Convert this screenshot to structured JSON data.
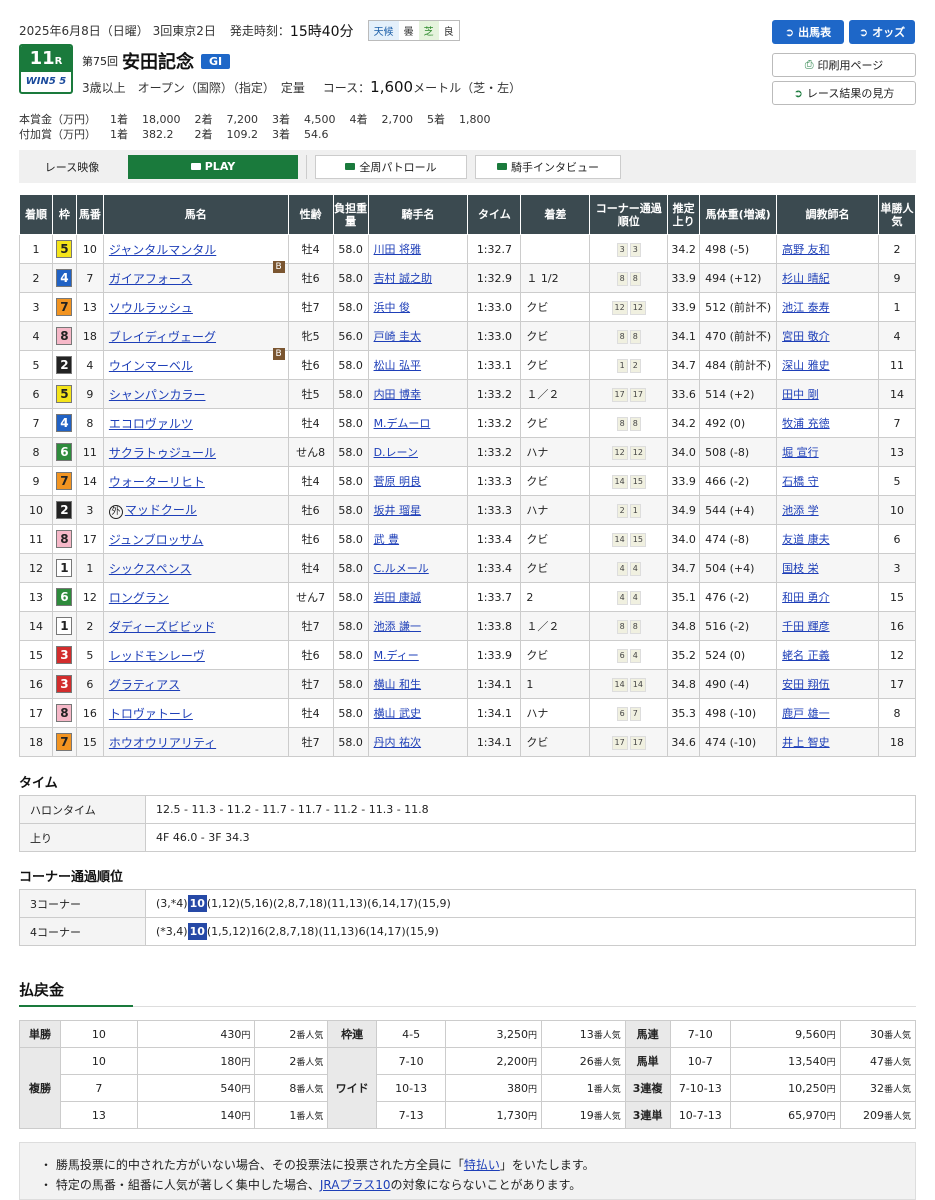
{
  "header": {
    "date": "2025年6月8日（日曜） 3回東京2日",
    "start_label": "発走時刻：",
    "start_time": "15時40分",
    "weather_label": "天候",
    "weather": "曇",
    "track_label": "芝",
    "track_cond": "良",
    "race_num": "11",
    "race_r": "R",
    "win5": "WIN5 5",
    "ordinal": "第75回",
    "race_name": "安田記念",
    "grade": "GI",
    "conditions": "3歳以上　オープン（国際）（指定）　定量",
    "course_label": "コース：",
    "distance": "1,600",
    "course_unit": "メートル（芝・左）"
  },
  "buttons": {
    "entry": "出馬表",
    "odds": "オッズ",
    "print": "印刷用ページ",
    "guide": "レース結果の見方"
  },
  "prize": {
    "main_label": "本賞金（万円）",
    "main": [
      "1着",
      "18,000",
      "2着",
      "7,200",
      "3着",
      "4,500",
      "4着",
      "2,700",
      "5着",
      "1,800"
    ],
    "add_label": "付加賞（万円）",
    "add": [
      "1着",
      "382.2",
      "2着",
      "109.2",
      "3着",
      "54.6"
    ]
  },
  "video": {
    "label": "レース映像",
    "play": "PLAY",
    "patrol": "全周パトロール",
    "interview": "騎手インタビュー"
  },
  "table_headers": [
    "着順",
    "枠",
    "馬番",
    "馬名",
    "性齢",
    "負担重量",
    "騎手名",
    "タイム",
    "着差",
    "コーナー通過順位",
    "推定上り",
    "馬体重(増減)",
    "調教師名",
    "単勝人気"
  ],
  "results": [
    {
      "pos": "1",
      "frame": "5",
      "num": "10",
      "horse": "ジャンタルマンタル",
      "mark": "",
      "sex": "牡4",
      "wt": "58.0",
      "jockey": "川田 将雅",
      "time": "1:32.7",
      "margin": "",
      "c1": "3",
      "c2": "3",
      "last": "34.2",
      "bw": "498 (-5)",
      "trainer": "高野 友和",
      "pop": "2"
    },
    {
      "pos": "2",
      "frame": "4",
      "num": "7",
      "horse": "ガイアフォース",
      "mark": "B",
      "sex": "牡6",
      "wt": "58.0",
      "jockey": "吉村 誠之助",
      "time": "1:32.9",
      "margin": "１ 1/2",
      "c1": "8",
      "c2": "8",
      "last": "33.9",
      "bw": "494 (+12)",
      "trainer": "杉山 晴紀",
      "pop": "9"
    },
    {
      "pos": "3",
      "frame": "7",
      "num": "13",
      "horse": "ソウルラッシュ",
      "mark": "",
      "sex": "牡7",
      "wt": "58.0",
      "jockey": "浜中 俊",
      "time": "1:33.0",
      "margin": "クビ",
      "c1": "12",
      "c2": "12",
      "last": "33.9",
      "bw": "512 (前計不)",
      "trainer": "池江 泰寿",
      "pop": "1"
    },
    {
      "pos": "4",
      "frame": "8",
      "num": "18",
      "horse": "ブレイディヴェーグ",
      "mark": "",
      "sex": "牝5",
      "wt": "56.0",
      "jockey": "戸崎 圭太",
      "time": "1:33.0",
      "margin": "クビ",
      "c1": "8",
      "c2": "8",
      "last": "34.1",
      "bw": "470 (前計不)",
      "trainer": "宮田 敬介",
      "pop": "4"
    },
    {
      "pos": "5",
      "frame": "2",
      "num": "4",
      "horse": "ウインマーベル",
      "mark": "B",
      "sex": "牡6",
      "wt": "58.0",
      "jockey": "松山 弘平",
      "time": "1:33.1",
      "margin": "クビ",
      "c1": "1",
      "c2": "2",
      "last": "34.7",
      "bw": "484 (前計不)",
      "trainer": "深山 雅史",
      "pop": "11"
    },
    {
      "pos": "6",
      "frame": "5",
      "num": "9",
      "horse": "シャンパンカラー",
      "mark": "",
      "sex": "牡5",
      "wt": "58.0",
      "jockey": "内田 博幸",
      "time": "1:33.2",
      "margin": "１／２",
      "c1": "17",
      "c2": "17",
      "last": "33.6",
      "bw": "514 (+2)",
      "trainer": "田中 剛",
      "pop": "14"
    },
    {
      "pos": "7",
      "frame": "4",
      "num": "8",
      "horse": "エコロヴァルツ",
      "mark": "",
      "sex": "牡4",
      "wt": "58.0",
      "jockey": "M.デムーロ",
      "time": "1:33.2",
      "margin": "クビ",
      "c1": "8",
      "c2": "8",
      "last": "34.2",
      "bw": "492 (0)",
      "trainer": "牧浦 充徳",
      "pop": "7"
    },
    {
      "pos": "8",
      "frame": "6",
      "num": "11",
      "horse": "サクラトゥジュール",
      "mark": "",
      "sex": "せん8",
      "wt": "58.0",
      "jockey": "D.レーン",
      "time": "1:33.2",
      "margin": "ハナ",
      "c1": "12",
      "c2": "12",
      "last": "34.0",
      "bw": "508 (-8)",
      "trainer": "堀 宣行",
      "pop": "13"
    },
    {
      "pos": "9",
      "frame": "7",
      "num": "14",
      "horse": "ウォーターリヒト",
      "mark": "",
      "sex": "牡4",
      "wt": "58.0",
      "jockey": "菅原 明良",
      "time": "1:33.3",
      "margin": "クビ",
      "c1": "14",
      "c2": "15",
      "last": "33.9",
      "bw": "466 (-2)",
      "trainer": "石橋 守",
      "pop": "5"
    },
    {
      "pos": "10",
      "frame": "2",
      "num": "3",
      "horse": "マッドクール",
      "mark": "外",
      "sex": "牡6",
      "wt": "58.0",
      "jockey": "坂井 瑠星",
      "time": "1:33.3",
      "margin": "ハナ",
      "c1": "2",
      "c2": "1",
      "last": "34.9",
      "bw": "544 (+4)",
      "trainer": "池添 学",
      "pop": "10"
    },
    {
      "pos": "11",
      "frame": "8",
      "num": "17",
      "horse": "ジュンブロッサム",
      "mark": "",
      "sex": "牡6",
      "wt": "58.0",
      "jockey": "武 豊",
      "time": "1:33.4",
      "margin": "クビ",
      "c1": "14",
      "c2": "15",
      "last": "34.0",
      "bw": "474 (-8)",
      "trainer": "友道 康夫",
      "pop": "6"
    },
    {
      "pos": "12",
      "frame": "1",
      "num": "1",
      "horse": "シックスペンス",
      "mark": "",
      "sex": "牡4",
      "wt": "58.0",
      "jockey": "C.ルメール",
      "time": "1:33.4",
      "margin": "クビ",
      "c1": "4",
      "c2": "4",
      "last": "34.7",
      "bw": "504 (+4)",
      "trainer": "国枝 栄",
      "pop": "3"
    },
    {
      "pos": "13",
      "frame": "6",
      "num": "12",
      "horse": "ロングラン",
      "mark": "",
      "sex": "せん7",
      "wt": "58.0",
      "jockey": "岩田 康誠",
      "time": "1:33.7",
      "margin": "2",
      "c1": "4",
      "c2": "4",
      "last": "35.1",
      "bw": "476 (-2)",
      "trainer": "和田 勇介",
      "pop": "15"
    },
    {
      "pos": "14",
      "frame": "1",
      "num": "2",
      "horse": "ダディーズビビッド",
      "mark": "",
      "sex": "牡7",
      "wt": "58.0",
      "jockey": "池添 謙一",
      "time": "1:33.8",
      "margin": "１／２",
      "c1": "8",
      "c2": "8",
      "last": "34.8",
      "bw": "516 (-2)",
      "trainer": "千田 輝彦",
      "pop": "16"
    },
    {
      "pos": "15",
      "frame": "3",
      "num": "5",
      "horse": "レッドモンレーヴ",
      "mark": "",
      "sex": "牡6",
      "wt": "58.0",
      "jockey": "M.ディー",
      "time": "1:33.9",
      "margin": "クビ",
      "c1": "6",
      "c2": "4",
      "last": "35.2",
      "bw": "524 (0)",
      "trainer": "蛯名 正義",
      "pop": "12"
    },
    {
      "pos": "16",
      "frame": "3",
      "num": "6",
      "horse": "グラティアス",
      "mark": "",
      "sex": "牡7",
      "wt": "58.0",
      "jockey": "横山 和生",
      "time": "1:34.1",
      "margin": "1",
      "c1": "14",
      "c2": "14",
      "last": "34.8",
      "bw": "490 (-4)",
      "trainer": "安田 翔伍",
      "pop": "17"
    },
    {
      "pos": "17",
      "frame": "8",
      "num": "16",
      "horse": "トロヴァトーレ",
      "mark": "",
      "sex": "牡4",
      "wt": "58.0",
      "jockey": "横山 武史",
      "time": "1:34.1",
      "margin": "ハナ",
      "c1": "6",
      "c2": "7",
      "last": "35.3",
      "bw": "498 (-10)",
      "trainer": "鹿戸 雄一",
      "pop": "8"
    },
    {
      "pos": "18",
      "frame": "7",
      "num": "15",
      "horse": "ホウオウリアリティ",
      "mark": "",
      "sex": "牡7",
      "wt": "58.0",
      "jockey": "丹内 祐次",
      "time": "1:34.1",
      "margin": "クビ",
      "c1": "17",
      "c2": "17",
      "last": "34.6",
      "bw": "474 (-10)",
      "trainer": "井上 智史",
      "pop": "18"
    }
  ],
  "frame_colors": {
    "1": [
      "#ffffff",
      "#222"
    ],
    "2": [
      "#222222",
      "#fff"
    ],
    "3": [
      "#d22d2d",
      "#fff"
    ],
    "4": [
      "#2162c4",
      "#fff"
    ],
    "5": [
      "#f4e41a",
      "#222"
    ],
    "6": [
      "#2e8b3c",
      "#fff"
    ],
    "7": [
      "#f29421",
      "#222"
    ],
    "8": [
      "#f6b8c8",
      "#222"
    ]
  },
  "time_section": {
    "title": "タイム",
    "furlong_label": "ハロンタイム",
    "furlong": "12.5 - 11.3 - 11.2 - 11.7 - 11.7 - 11.2 - 11.3 - 11.8",
    "last_label": "上り",
    "last": "4F 46.0 - 3F 34.3"
  },
  "corner_section": {
    "title": "コーナー通過順位",
    "c3_label": "3コーナー",
    "c3_pre": "(3,*4)",
    "c3_hl": "10",
    "c3_post": "(1,12)(5,16)(2,8,7,18)(11,13)(6,14,17)(15,9)",
    "c4_label": "4コーナー",
    "c4_pre": "(*3,4)",
    "c4_hl": "10",
    "c4_post": "(1,5,12)16(2,8,7,18)(11,13)6(14,17)(15,9)"
  },
  "payout": {
    "title": "払戻金",
    "yen": "円",
    "pop_suffix": "番人気",
    "tan": {
      "label": "単勝",
      "num": "10",
      "amt": "430",
      "pop": "2"
    },
    "fuku_label": "複勝",
    "fuku": [
      {
        "num": "10",
        "amt": "180",
        "pop": "2"
      },
      {
        "num": "7",
        "amt": "540",
        "pop": "8"
      },
      {
        "num": "13",
        "amt": "140",
        "pop": "1"
      }
    ],
    "waku": {
      "label": "枠連",
      "num": "4-5",
      "amt": "3,250",
      "pop": "13"
    },
    "wide_label": "ワイド",
    "wide": [
      {
        "num": "7-10",
        "amt": "2,200",
        "pop": "26"
      },
      {
        "num": "10-13",
        "amt": "380",
        "pop": "1"
      },
      {
        "num": "7-13",
        "amt": "1,730",
        "pop": "19"
      }
    ],
    "uma": {
      "label": "馬連",
      "num": "7-10",
      "amt": "9,560",
      "pop": "30"
    },
    "umatan": {
      "label": "馬単",
      "num": "10-7",
      "amt": "13,540",
      "pop": "47"
    },
    "fuku3": {
      "label": "3連複",
      "num": "7-10-13",
      "amt": "10,250",
      "pop": "32"
    },
    "tan3": {
      "label": "3連単",
      "num": "10-7-13",
      "amt": "65,970",
      "pop": "209"
    }
  },
  "notes": {
    "n1_pre": "・ 勝馬投票に的中された方がいない場合、その投票法に投票された方全員に「",
    "n1_link": "特払い",
    "n1_post": "」をいたします。",
    "n2_pre": "・ 特定の馬番・組番に人気が著しく集中した場合、",
    "n2_link": "JRAプラス10",
    "n2_post": "の対象にならないことがあります。"
  }
}
